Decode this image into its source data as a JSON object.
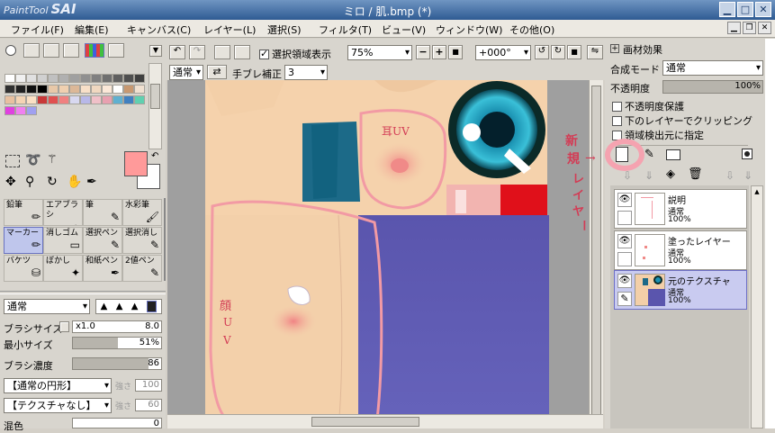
{
  "window": {
    "logo_small": "PaintTool",
    "logo": "SAI",
    "title": "ミロ / 肌.bmp (*)"
  },
  "menu": [
    "ファイル(F)",
    "編集(E)",
    "キャンバス(C)",
    "レイヤー(L)",
    "選択(S)",
    "フィルタ(T)",
    "ビュー(V)",
    "ウィンドウ(W)",
    "その他(O)"
  ],
  "canvas_toolbar": {
    "selection_display": "選択領域表示",
    "zoom": "75%",
    "angle": "+000°",
    "blend": "通常",
    "stabilizer_label": "手ブレ補正",
    "stabilizer": "3"
  },
  "palette_colors": [
    "#ffffff",
    "#f0f0f0",
    "#e0e0e0",
    "#d0d0d0",
    "#c0c0c0",
    "#b0b0b0",
    "#a0a0a0",
    "#909090",
    "#808080",
    "#707070",
    "#606060",
    "#505050",
    "#404040",
    "#303030",
    "#202020",
    "#101010",
    "#000000",
    "#e8c8a8",
    "#f0d0b0",
    "#dcb898",
    "#f8e0c8",
    "#f0d8c0",
    "#fbe8d8",
    "#ffffff",
    "#c89870",
    "#f0e0d0",
    "#e8c0a0",
    "#f4d4b4",
    "#fae0c4",
    "#c83838",
    "#e05050",
    "#f08080",
    "#d8d8f0",
    "#b8b8e8",
    "#f0c0c8",
    "#e8a0b0",
    "#60b0d0",
    "#4080c0",
    "#60d0b0",
    "#e040e0",
    "#f080f0",
    "#a0a0f0"
  ],
  "main_color": "#ff9a9a",
  "tools": [
    {
      "label": "鉛筆",
      "active": false
    },
    {
      "label": "エアブラシ",
      "active": false
    },
    {
      "label": "筆",
      "active": false
    },
    {
      "label": "水彩筆",
      "active": false
    },
    {
      "label": "マーカー",
      "active": true
    },
    {
      "label": "消しゴム",
      "active": false
    },
    {
      "label": "選択ペン",
      "active": false
    },
    {
      "label": "選択消し",
      "active": false
    },
    {
      "label": "バケツ",
      "active": false
    },
    {
      "label": "ぼかし",
      "active": false
    },
    {
      "label": "和紙ペン",
      "active": false
    },
    {
      "label": "2値ペン",
      "active": false
    }
  ],
  "brush": {
    "mode": "通常",
    "size_label": "ブラシサイズ",
    "size_mult": "x1.0",
    "size_value": "8.0",
    "min_size_label": "最小サイズ",
    "min_size_value": "51%",
    "min_size_fraction": 0.51,
    "density_label": "ブラシ濃度",
    "density_value": "86",
    "density_fraction": 0.86,
    "shape": "【通常の円形】",
    "shape_strength_label": "強さ",
    "shape_strength": "100",
    "texture": "【テクスチャなし】",
    "texture_strength_label": "強さ",
    "texture_strength": "60",
    "mix_label": "混色",
    "mix_value": "0"
  },
  "layer_panel": {
    "effects_label": "画材効果",
    "blend_label": "合成モード",
    "blend_value": "通常",
    "opacity_label": "不透明度",
    "opacity_value": "100%",
    "protect_opacity": "不透明度保護",
    "clip": "下のレイヤーでクリッピング",
    "selection_source": "領域検出元に指定"
  },
  "layers": [
    {
      "name": "説明",
      "mode": "通常",
      "opacity": "100%",
      "selected": false
    },
    {
      "name": "塗ったレイヤー",
      "mode": "通常",
      "opacity": "100%",
      "selected": false
    },
    {
      "name": "元のテクスチャ",
      "mode": "通常",
      "opacity": "100%",
      "selected": true
    }
  ],
  "annotations": {
    "ear_uv": "耳UV",
    "face_uv_1": "顔",
    "face_uv_2": "U",
    "face_uv_3": "V",
    "new_layer_1": "新",
    "new_layer_2": "規",
    "new_layer_3": "レ",
    "new_layer_4": "イ",
    "new_layer_5": "ヤ",
    "new_layer_6": "ー"
  }
}
